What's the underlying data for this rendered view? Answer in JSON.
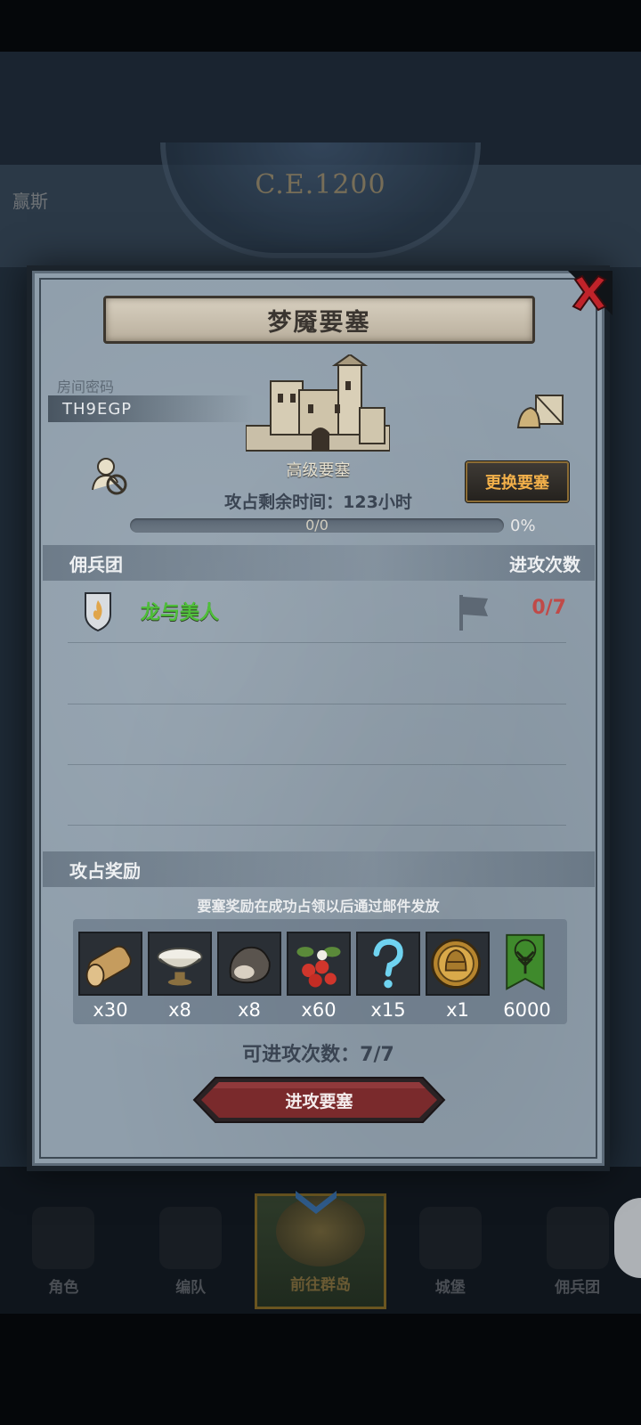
{
  "background": {
    "era": "C.E.1200",
    "left_text": "赢斯"
  },
  "modal": {
    "title": "梦魇要塞",
    "room_label": "房间密码",
    "room_code": "TH9EGP",
    "fortress_grade": "高级要塞",
    "change_button": "更换要塞",
    "time_label": "攻占剩余时间：",
    "time_value": "123小时",
    "progress": {
      "text": "0/0",
      "fraction": 0,
      "percent": "0%"
    },
    "mercenary_header": "佣兵团",
    "attack_count_header": "进攻次数",
    "mercenaries": [
      {
        "name": "龙与美人",
        "attacks": "0/7"
      }
    ],
    "reward_header": "攻占奖励",
    "reward_note": "要塞奖励在成功占领以后通过邮件发放",
    "rewards": [
      {
        "icon": "wood-log-icon",
        "qty": "x30"
      },
      {
        "icon": "porcelain-bowl-icon",
        "qty": "x8"
      },
      {
        "icon": "truffle-icon",
        "qty": "x8"
      },
      {
        "icon": "berries-icon",
        "qty": "x60"
      },
      {
        "icon": "mystery-question-icon",
        "qty": "x15"
      },
      {
        "icon": "knight-coin-icon",
        "qty": "x1"
      },
      {
        "icon": "green-tree-banner-icon",
        "qty": "6000"
      }
    ],
    "attempts_label": "可进攻次数：",
    "attempts_value": "7/7",
    "attack_button": "进攻要塞"
  },
  "bottom_nav": {
    "items": [
      {
        "label": "角色"
      },
      {
        "label": "编队"
      },
      {
        "label": "前往群岛",
        "active": true
      },
      {
        "label": "城堡"
      },
      {
        "label": "佣兵团"
      }
    ]
  },
  "colors": {
    "panel": "#8f9eab",
    "merc_name": "#4fbf3a",
    "attack_count": "#c04a48",
    "change_button_text": "#f2b04a",
    "attack_button": "#7a2a2c"
  }
}
